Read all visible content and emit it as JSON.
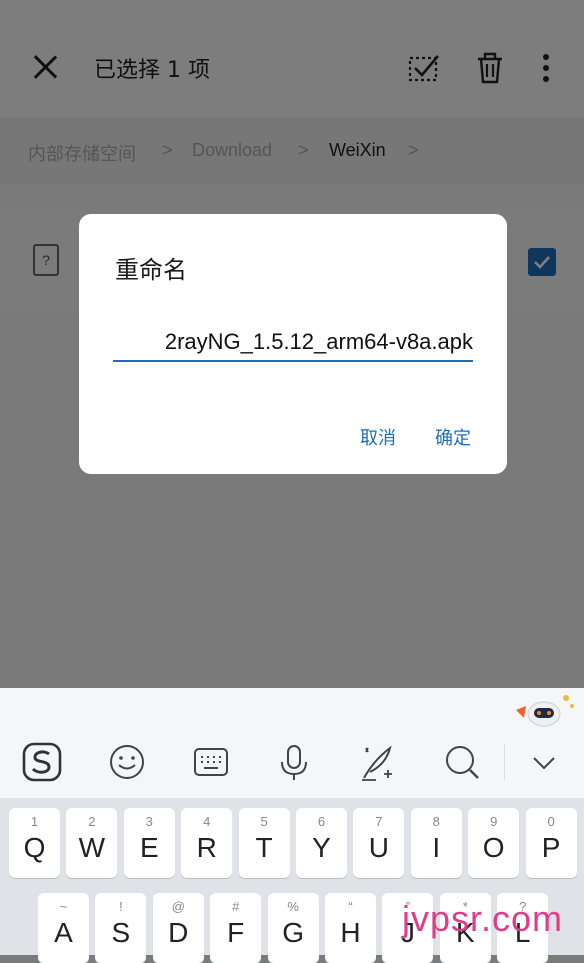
{
  "header": {
    "title": "已选择 1 项"
  },
  "breadcrumb": {
    "items": [
      "内部存储空间",
      "Download",
      "WeiXin"
    ],
    "separator": ">"
  },
  "dialog": {
    "title": "重命名",
    "filename": "2rayNG_1.5.12_arm64-v8a.apk",
    "cancel": "取消",
    "confirm": "确定"
  },
  "file_row": {
    "icon_glyph": "?"
  },
  "keyboard": {
    "row1": [
      {
        "sub": "1",
        "key": "Q"
      },
      {
        "sub": "2",
        "key": "W"
      },
      {
        "sub": "3",
        "key": "E"
      },
      {
        "sub": "4",
        "key": "R"
      },
      {
        "sub": "5",
        "key": "T"
      },
      {
        "sub": "6",
        "key": "Y"
      },
      {
        "sub": "7",
        "key": "U"
      },
      {
        "sub": "8",
        "key": "I"
      },
      {
        "sub": "9",
        "key": "O"
      },
      {
        "sub": "0",
        "key": "P"
      }
    ],
    "row2": [
      {
        "sub": "~",
        "key": "A"
      },
      {
        "sub": "!",
        "key": "S"
      },
      {
        "sub": "@",
        "key": "D"
      },
      {
        "sub": "#",
        "key": "F"
      },
      {
        "sub": "%",
        "key": "G"
      },
      {
        "sub": "“",
        "key": "H"
      },
      {
        "sub": "”",
        "key": "J"
      },
      {
        "sub": "*",
        "key": "K"
      },
      {
        "sub": "?",
        "key": "L"
      }
    ]
  },
  "watermark": "jvpsr.com",
  "colors": {
    "accent": "#1e6fb8",
    "watermark": "#e33a8c"
  }
}
